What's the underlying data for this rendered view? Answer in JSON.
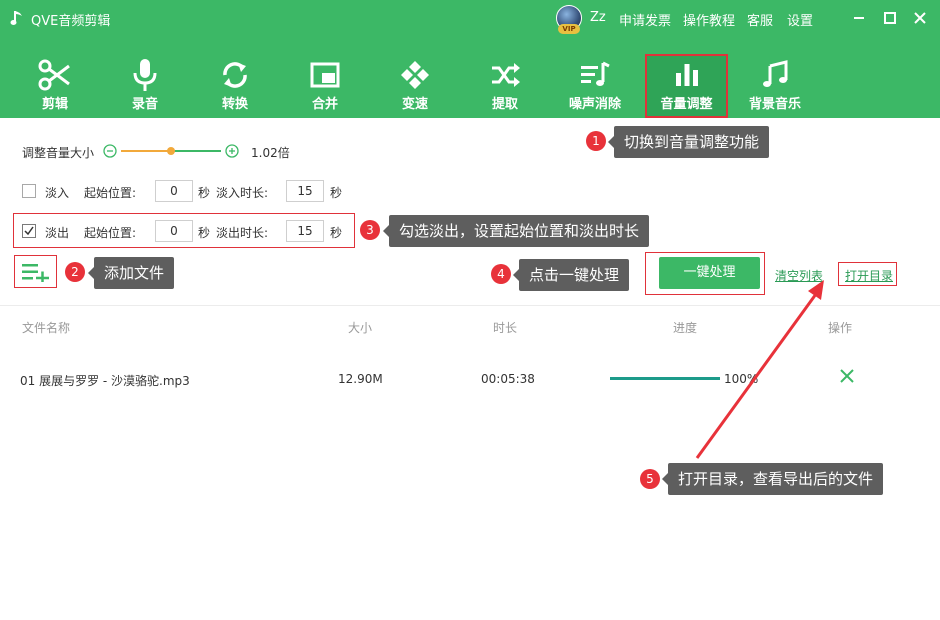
{
  "app": {
    "title": "QVE音频剪辑"
  },
  "titlebar": {
    "vip_label": "VIP",
    "username": "Zz",
    "links": [
      "申请发票",
      "操作教程",
      "客服",
      "设置"
    ]
  },
  "toolbar": {
    "tools": [
      {
        "label": "剪辑",
        "icon": "scissors-icon"
      },
      {
        "label": "录音",
        "icon": "microphone-icon"
      },
      {
        "label": "转换",
        "icon": "convert-icon"
      },
      {
        "label": "合并",
        "icon": "merge-icon"
      },
      {
        "label": "变速",
        "icon": "speed-icon"
      },
      {
        "label": "提取",
        "icon": "extract-icon"
      },
      {
        "label": "噪声消除",
        "icon": "noise-removal-icon"
      },
      {
        "label": "音量调整",
        "icon": "volume-bars-icon",
        "active": true
      },
      {
        "label": "背景音乐",
        "icon": "music-note-icon"
      }
    ]
  },
  "volume": {
    "label": "调整音量大小",
    "value_text": "1.02倍",
    "slider_fraction": 0.5
  },
  "fade_in": {
    "checked": false,
    "label": "淡入",
    "start_label": "起始位置:",
    "start_value": "0",
    "start_unit": "秒",
    "duration_label": "淡入时长:",
    "duration_value": "15",
    "duration_unit": "秒"
  },
  "fade_out": {
    "checked": true,
    "label": "淡出",
    "start_label": "起始位置:",
    "start_value": "0",
    "start_unit": "秒",
    "duration_label": "淡出时长:",
    "duration_value": "15",
    "duration_unit": "秒"
  },
  "actions": {
    "process_label": "一键处理",
    "clear_label": "清空列表",
    "open_dir_label": "打开目录"
  },
  "table": {
    "columns": [
      "文件名称",
      "大小",
      "时长",
      "进度",
      "操作"
    ],
    "rows": [
      {
        "name": "01 展展与罗罗 - 沙漠骆驼.mp3",
        "size": "12.90M",
        "duration": "00:05:38",
        "progress_text": "100%",
        "progress": 1.0
      }
    ]
  },
  "annotations": [
    {
      "number": "1",
      "text": "切换到音量调整功能"
    },
    {
      "number": "2",
      "text": "添加文件"
    },
    {
      "number": "3",
      "text": "勾选淡出，设置起始位置和淡出时长"
    },
    {
      "number": "4",
      "text": "点击一键处理"
    },
    {
      "number": "5",
      "text": "打开目录，查看导出后的文件"
    }
  ],
  "colors": {
    "brand": "#3cb866",
    "annotation_red": "#e8323a",
    "callout_bg": "#5e5e5e",
    "progress": "#1d9b8a"
  }
}
